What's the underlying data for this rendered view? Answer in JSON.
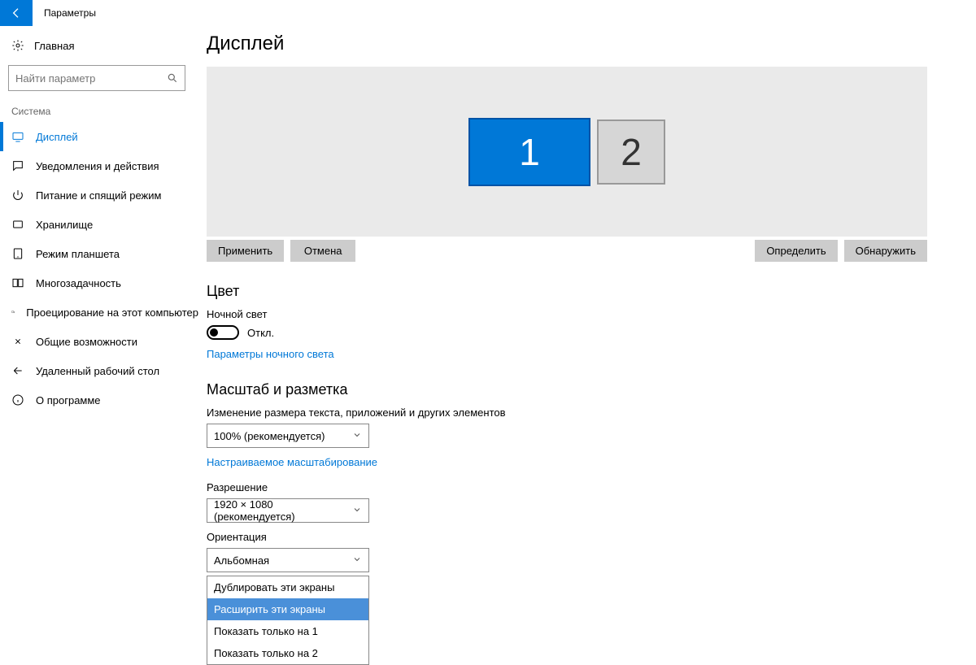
{
  "window": {
    "title": "Параметры"
  },
  "sidebar": {
    "home": "Главная",
    "search_placeholder": "Найти параметр",
    "group": "Система",
    "items": [
      {
        "label": "Дисплей"
      },
      {
        "label": "Уведомления и действия"
      },
      {
        "label": "Питание и спящий режим"
      },
      {
        "label": "Хранилище"
      },
      {
        "label": "Режим планшета"
      },
      {
        "label": "Многозадачность"
      },
      {
        "label": "Проецирование на этот компьютер"
      },
      {
        "label": "Общие возможности"
      },
      {
        "label": "Удаленный рабочий стол"
      },
      {
        "label": "О программе"
      }
    ]
  },
  "content": {
    "heading": "Дисплей",
    "mon1": "1",
    "mon2": "2",
    "buttons": {
      "apply": "Применить",
      "cancel": "Отмена",
      "identify": "Определить",
      "detect": "Обнаружить"
    },
    "color_heading": "Цвет",
    "nightlight_label": "Ночной свет",
    "nightlight_state": "Откл.",
    "nightlight_link": "Параметры ночного света",
    "scale_heading": "Масштаб и разметка",
    "scale_label": "Изменение размера текста, приложений и других элементов",
    "scale_value": "100% (рекомендуется)",
    "scale_link": "Настраиваемое масштабирование",
    "resolution_label": "Разрешение",
    "resolution_value": "1920 × 1080 (рекомендуется)",
    "orientation_label": "Ориентация",
    "orientation_value": "Альбомная",
    "multidisplay_options": [
      "Дублировать эти экраны",
      "Расширить эти экраны",
      "Показать только на 1",
      "Показать только на 2"
    ]
  }
}
